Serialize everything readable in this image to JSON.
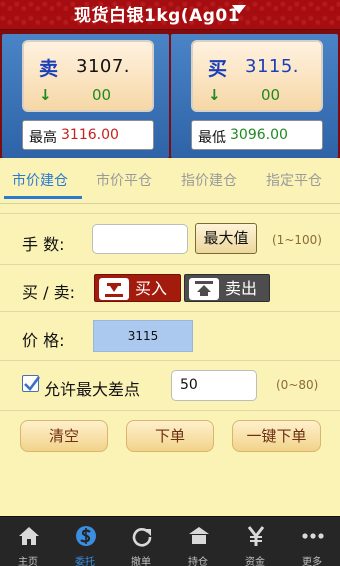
{
  "header": {
    "title": "现货白银1kg(Ag01"
  },
  "quote": {
    "sell": {
      "label": "卖",
      "price": "3107.",
      "arrow": "↓",
      "change": "00",
      "hl_label": "最高",
      "hl_value": "3116.00"
    },
    "buy": {
      "label": "买",
      "price": "3115.",
      "arrow": "↓",
      "change": "00",
      "hl_label": "最低",
      "hl_value": "3096.00"
    }
  },
  "tabs": [
    {
      "label": "市价建仓",
      "active": true
    },
    {
      "label": "市价平仓",
      "active": false
    },
    {
      "label": "指价建仓",
      "active": false
    },
    {
      "label": "指定平仓",
      "active": false
    }
  ],
  "form": {
    "quantity": {
      "label": "手    数:",
      "value": "",
      "max_label": "最大值",
      "range": "(1~100)"
    },
    "direction": {
      "label": "买 / 卖:",
      "buy_label": "买入",
      "sell_label": "卖出"
    },
    "price": {
      "label": "价    格:",
      "value": "3115"
    },
    "spread": {
      "label": "允许最大差点",
      "value": "50",
      "range": "(0~80)",
      "checked": true
    }
  },
  "actions": {
    "clear": "清空",
    "order": "下单",
    "one_click": "一键下单"
  },
  "tabbar": [
    {
      "label": "主页",
      "icon": "home-icon",
      "active": false
    },
    {
      "label": "委托",
      "icon": "order-icon",
      "active": true
    },
    {
      "label": "撤单",
      "icon": "undo-icon",
      "active": false
    },
    {
      "label": "持仓",
      "icon": "position-icon",
      "active": false
    },
    {
      "label": "资金",
      "icon": "yen-icon",
      "active": false
    },
    {
      "label": "更多",
      "icon": "more-icon",
      "active": false
    }
  ],
  "colors": {
    "accent": "#2a7bd0",
    "header_red": "#a50d10",
    "panel_blue": "#2e63a8",
    "background": "#fbf3b6"
  }
}
